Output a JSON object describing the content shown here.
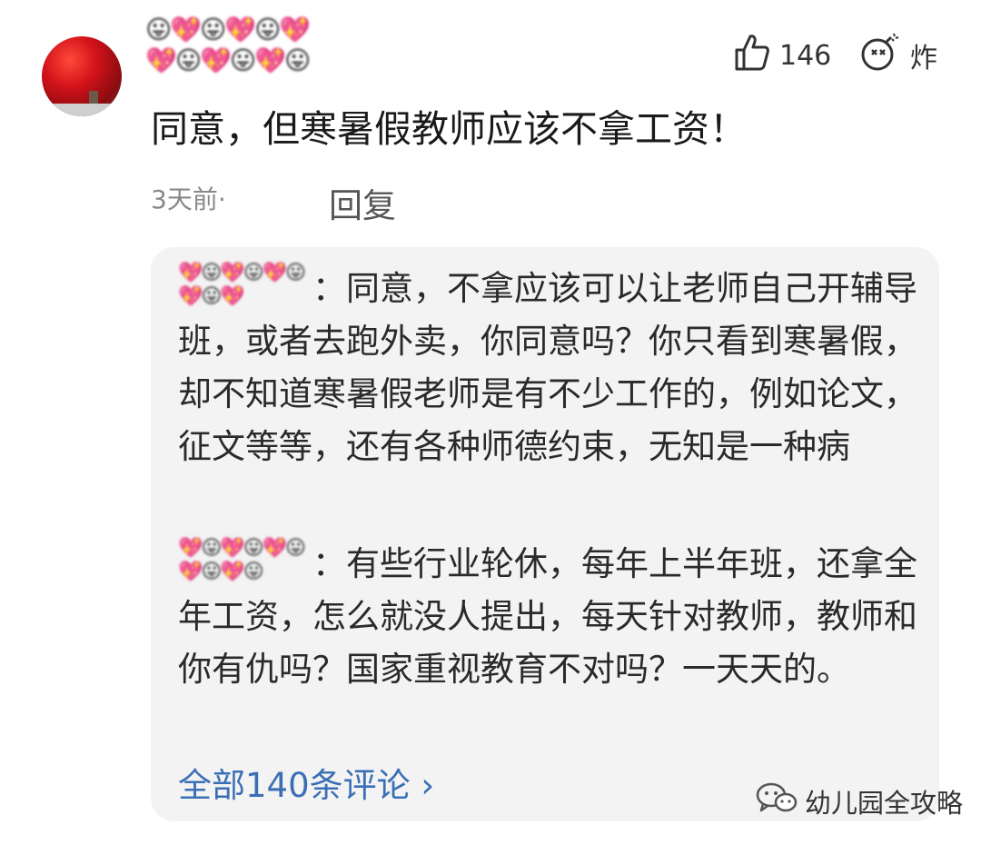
{
  "comment": {
    "username_emoji": "😛💖😛💖😛💖💖😛💖😛💖😛",
    "text": "同意，但寒暑假教师应该不拿工资！",
    "time": "3天前",
    "separator": "·",
    "reply_label": "回复",
    "likes": "146",
    "bomb_label": "炸"
  },
  "replies": [
    {
      "name_emoji": "💖😛💖😛💖😛💖😛💖",
      "colon": "：",
      "text": "同意，不拿应该可以让老师自己开辅导班，或者去跑外卖，你同意吗？你只看到寒暑假，却不知道寒暑假老师是有不少工作的，例如论文，征文等等，还有各种师德约束，无知是一种病"
    },
    {
      "name_emoji": "💖😛💖😛💖😛💖😛💖😛",
      "colon": "：",
      "text": "有些行业轮休，每年上半年班，还拿全年工资，怎么就没人提出，每天针对教师，教师和你有仇吗？国家重视教育不对吗？一天天的。"
    }
  ],
  "more_comments": "全部140条评论 ›",
  "watermark": "幼儿园全攻略",
  "colors": {
    "link": "#3b6fb5",
    "box": "#f3f3f3",
    "meta": "#888888"
  },
  "icons": [
    "thumb-up-icon",
    "bomb-icon",
    "wechat-icon"
  ]
}
